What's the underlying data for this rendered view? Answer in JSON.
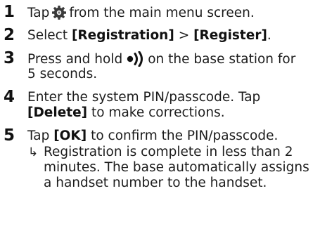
{
  "steps": [
    {
      "number": "1",
      "lines": {
        "a_pre": "Tap",
        "a_post": "from the main menu screen."
      },
      "icons": {
        "settings": "settings-gear-icon"
      }
    },
    {
      "number": "2",
      "lines": {
        "a_pre": "Select",
        "a_b1": "[Registration]",
        "a_mid": ">",
        "a_b2": "[Register]",
        "a_post": "."
      }
    },
    {
      "number": "3",
      "lines": {
        "a_pre": "Press and hold",
        "a_post": "on the base station for",
        "b": "5 seconds."
      },
      "icons": {
        "paging": "paging-signal-icon"
      }
    },
    {
      "number": "4",
      "lines": {
        "a": "Enter the system PIN/passcode. Tap",
        "b_bold": "[Delete]",
        "b_post": "to make corrections."
      }
    },
    {
      "number": "5",
      "lines": {
        "a_pre": "Tap",
        "a_bold": "[OK]",
        "a_post": "to confirm the PIN/passcode."
      },
      "result": {
        "arrow": "↳",
        "line1": "Registration is complete in less than 2",
        "line2": "minutes. The base automatically assigns",
        "line3": "a handset number to the handset."
      }
    }
  ],
  "colors": {
    "text": "#1c1c1c",
    "icon": "#333333"
  }
}
